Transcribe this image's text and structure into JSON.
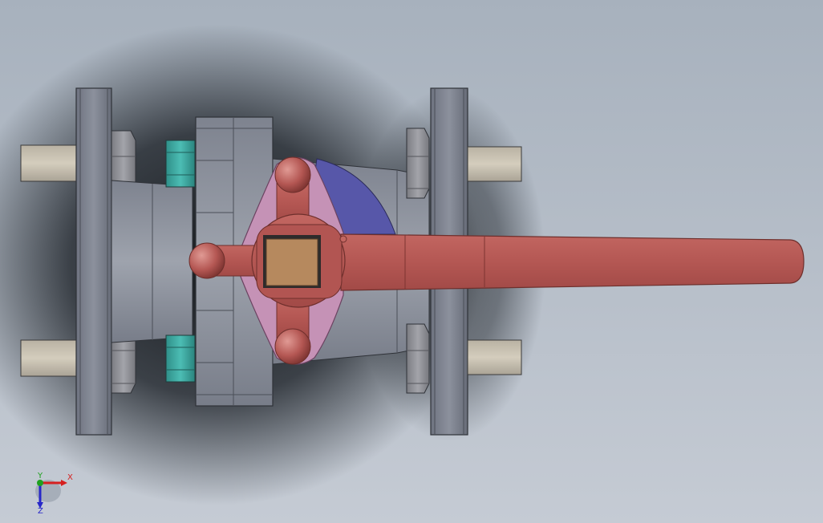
{
  "viewport": {
    "background_top": "#a9b3bf",
    "background_bottom": "#c6ccd5",
    "shadow_color": "#0f1216"
  },
  "model": {
    "flange_color": "#7a7f8b",
    "flange_edge": "#3a3d45",
    "bolt_color": "#c9c0b0",
    "nut_color": "#8e8f94",
    "body_color": "#8d929d",
    "cap_nut_color": "#3fa9a1",
    "handle_color": "#b85a55",
    "handle_dark": "#8a3d3a",
    "gland_plate_color": "#c592b6",
    "stop_color": "#5555a8",
    "stem_color": "#b6895e"
  },
  "triad": {
    "x_label": "X",
    "y_label": "Y",
    "z_label": "Z",
    "x_color": "#d62020",
    "y_color": "#1fa11f",
    "z_color": "#2727c8"
  }
}
